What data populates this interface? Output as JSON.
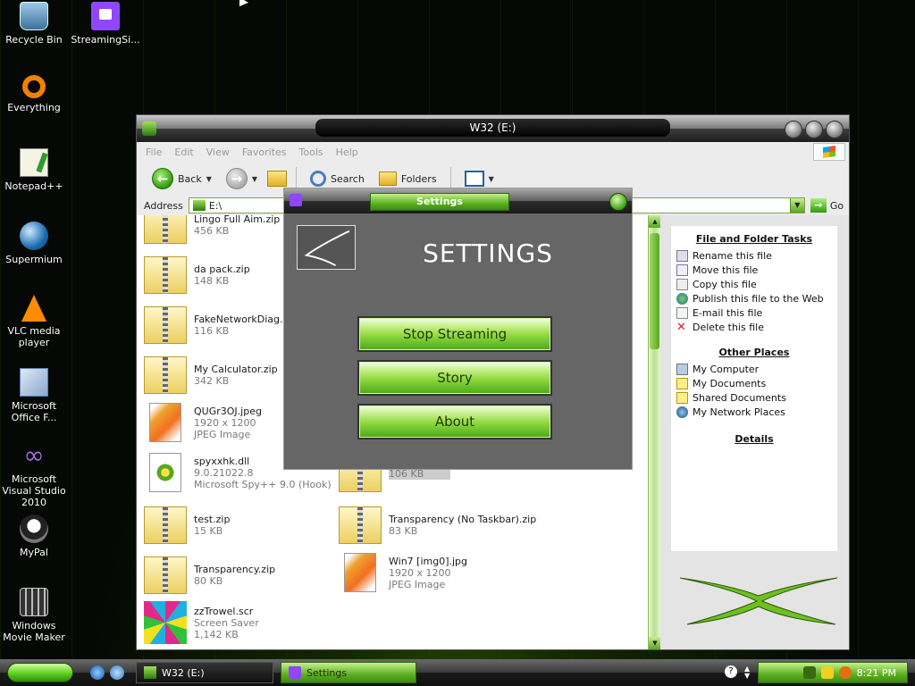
{
  "desktop": {
    "icons": [
      {
        "label": "Recycle Bin",
        "icon": "recycle-bin-icon"
      },
      {
        "label": "StreamingSi...",
        "icon": "twitch-icon"
      },
      {
        "label": "Everything",
        "icon": "everything-icon"
      },
      {
        "label": "Notepad++",
        "icon": "notepad-plus-plus-icon"
      },
      {
        "label": "Supermium",
        "icon": "supermium-icon"
      },
      {
        "label": "VLC media player",
        "icon": "vlc-icon"
      },
      {
        "label": "Microsoft Office F...",
        "icon": "office-icon"
      },
      {
        "label": "Microsoft Visual Studio 2010",
        "icon": "visual-studio-icon"
      },
      {
        "label": "MyPal",
        "icon": "mypal-icon"
      },
      {
        "label": "Windows Movie Maker",
        "icon": "movie-maker-icon"
      }
    ]
  },
  "explorer": {
    "title": "W32 (E:)",
    "menu": [
      "File",
      "Edit",
      "View",
      "Favorites",
      "Tools",
      "Help"
    ],
    "toolbar": {
      "back": "Back",
      "search": "Search",
      "folders": "Folders"
    },
    "address": {
      "label": "Address",
      "value": "E:\\",
      "go": "Go"
    },
    "files": [
      {
        "name": "Lingo Full Aim.zip",
        "line2": "456 KB",
        "line3": "",
        "kind": "zip"
      },
      {
        "name": "da pack.zip",
        "line2": "148 KB",
        "line3": "",
        "kind": "zip"
      },
      {
        "name": "FakeNetworkDiag.zip",
        "line2": "116 KB",
        "line3": "",
        "kind": "zip"
      },
      {
        "name": "My Calculator.zip",
        "line2": "342 KB",
        "line3": "",
        "kind": "zip"
      },
      {
        "name": "QUGr3OJ.jpeg",
        "line2": "1920 x 1200",
        "line3": "JPEG Image",
        "kind": "image"
      },
      {
        "name": "spyxxhk.dll",
        "line2": "9.0.21022.8",
        "line3": "Microsoft Spy++ 9.0 (Hook)",
        "kind": "dll"
      },
      {
        "name": "test.zip",
        "line2": "15 KB",
        "line3": "",
        "kind": "zip"
      },
      {
        "name": "Transparency.zip",
        "line2": "80 KB",
        "line3": "",
        "kind": "zip"
      },
      {
        "name": "zzTrowel.scr",
        "line2": "Screen Saver",
        "line3": "1,142 KB",
        "kind": "scr"
      },
      {
        "name": "",
        "line2": "106 KB",
        "line3": "",
        "kind": "zip"
      },
      {
        "name": "Transparency (No Taskbar).zip",
        "line2": "83 KB",
        "line3": "",
        "kind": "zip"
      },
      {
        "name": "Win7 [img0].jpg",
        "line2": "1920 x 1200",
        "line3": "JPEG Image",
        "kind": "image"
      }
    ],
    "tasks": {
      "file_folder_title": "File and Folder Tasks",
      "file_folder": [
        "Rename this file",
        "Move this file",
        "Copy this file",
        "Publish this file to the Web",
        "E-mail this file",
        "Delete this file"
      ],
      "other_title": "Other Places",
      "other": [
        "My Computer",
        "My Documents",
        "Shared Documents",
        "My Network Places"
      ],
      "details_title": "Details"
    }
  },
  "settings": {
    "title_bar": "Settings",
    "heading": "SETTINGS",
    "buttons": [
      "Stop Streaming",
      "Story",
      "About"
    ]
  },
  "taskbar": {
    "items": [
      "W32 (E:)",
      "Settings"
    ],
    "clock": "8:21 PM"
  }
}
